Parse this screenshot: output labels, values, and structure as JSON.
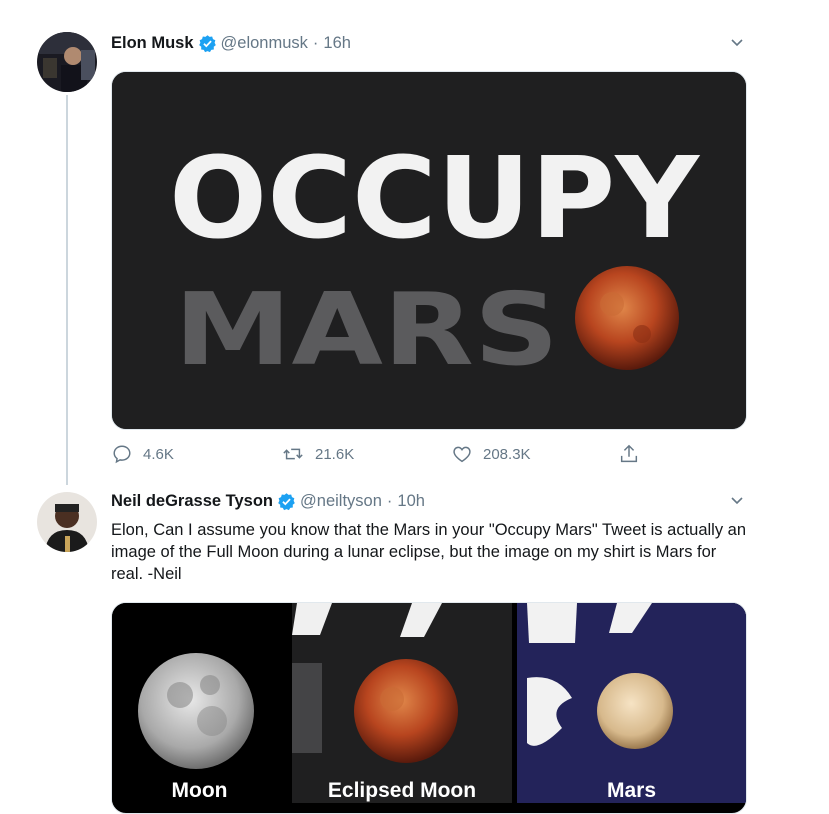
{
  "tweet1": {
    "name": "Elon Musk",
    "handle": "@elonmusk",
    "dot": "·",
    "time": "16h",
    "image": {
      "line1": "OCCUPY",
      "line2": "MARS"
    },
    "actions": {
      "reply_count": "4.6K",
      "retweet_count": "21.6K",
      "like_count": "208.3K"
    }
  },
  "tweet2": {
    "name": "Neil deGrasse Tyson",
    "handle": "@neiltyson",
    "dot": "·",
    "time": "10h",
    "text": "Elon, Can I assume you know that the Mars in your \"Occupy Mars\" Tweet is actually an image of the Full Moon during a lunar eclipse, but the image on my shirt is Mars for real. -Neil",
    "panels": [
      {
        "caption": "Moon"
      },
      {
        "caption": "Eclipsed Moon"
      },
      {
        "caption": "Mars"
      }
    ]
  },
  "colors": {
    "verified": "#1da1f2",
    "secondary_text": "#657786",
    "thread_line": "#ccd6dd",
    "media_bg": "#1f1f20"
  },
  "icons": [
    "verified-badge-icon",
    "chevron-down-icon",
    "reply-icon",
    "retweet-icon",
    "like-icon",
    "share-icon"
  ]
}
